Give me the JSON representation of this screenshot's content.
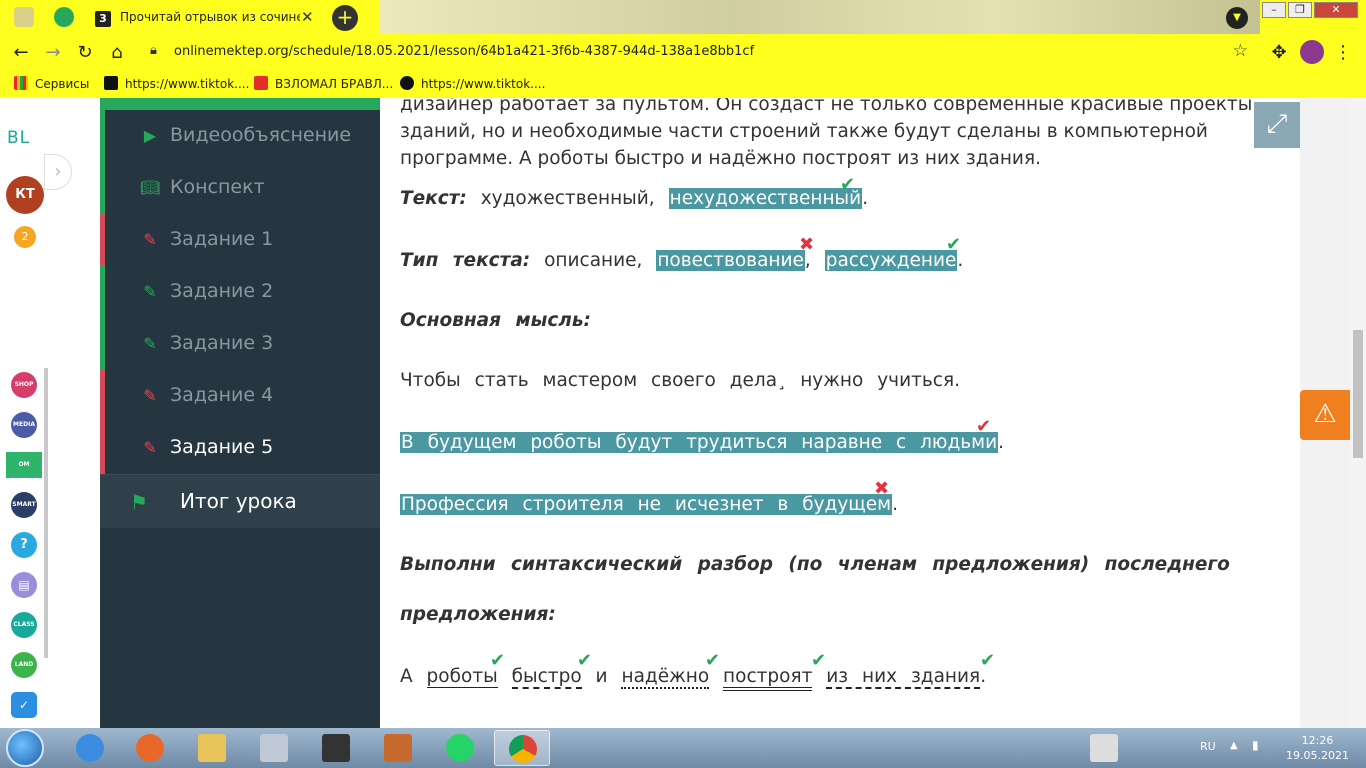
{
  "browser": {
    "active_tab": {
      "favicon": "3",
      "title": "Прочитай отрывок из сочинени",
      "close": "✕"
    },
    "new_tab": "+",
    "url": "onlinemektep.org/schedule/18.05.2021/lesson/64b1a421-3f6b-4387-944d-138a1e8bb1cf",
    "bookmarks": [
      {
        "label": "Сервисы",
        "icon": "apps-icon"
      },
      {
        "label": "https://www.tiktok....",
        "icon": "tiktok-icon"
      },
      {
        "label": "ВЗЛОМАЛ БРАВЛ...",
        "icon": "youtube-icon"
      },
      {
        "label": "https://www.tiktok....",
        "icon": "tiktok-icon"
      }
    ]
  },
  "rail": {
    "logo": "BL",
    "avatar": "КТ",
    "badge": "2"
  },
  "sidebar": {
    "items": [
      {
        "label": "Видеообъяснение",
        "status": "done",
        "icon": "play-icon"
      },
      {
        "label": "Конспект",
        "status": "done",
        "icon": "book-icon"
      },
      {
        "label": "Задание 1",
        "status": "failed",
        "icon": "edit-icon"
      },
      {
        "label": "Задание 2",
        "status": "done",
        "icon": "edit-icon"
      },
      {
        "label": "Задание 3",
        "status": "done",
        "icon": "edit-icon"
      },
      {
        "label": "Задание 4",
        "status": "failed",
        "icon": "edit-icon"
      },
      {
        "label": "Задание 5",
        "status": "failed",
        "icon": "edit-icon"
      }
    ],
    "summary": "Итог урока"
  },
  "content": {
    "para_line1": "дизайнер работает за пультом. Он создаст не только современные красивые проекты",
    "para_line2": "зданий, но и необходимые части строений также будут сделаны в компьютерной",
    "para_line3": "программе. А роботы быстро и надёжно построят из них здания.",
    "text_type": {
      "label": "Текст:",
      "opt1": "художественный,",
      "opt2": "нехудожественный",
      "end": "."
    },
    "text_kind": {
      "label": "Тип текста:",
      "opt1": "описание,",
      "opt2": "повествование",
      "sep": ",",
      "opt3": "рассуждение",
      "end": "."
    },
    "main_idea_label": "Основная мысль:",
    "idea1": "Чтобы стать мастером своего дела¸ нужно учиться.",
    "idea2": "В будущем роботы будут трудиться наравне с людьми",
    "idea3": "Профессия строителя не исчезнет в будущем",
    "dot": ".",
    "task_line1": "Выполни синтаксический разбор (по членам предложения) последнего",
    "task_line2": "предложения:",
    "parse": {
      "w1": "А",
      "w2": "роботы",
      "w3": "быстро",
      "w4": "и",
      "w5": "надёжно",
      "w6": "построят",
      "w7": "из них здания",
      "end": "."
    }
  },
  "taskbar": {
    "lang": "RU",
    "time": "12:26",
    "date": "19.05.2021"
  }
}
